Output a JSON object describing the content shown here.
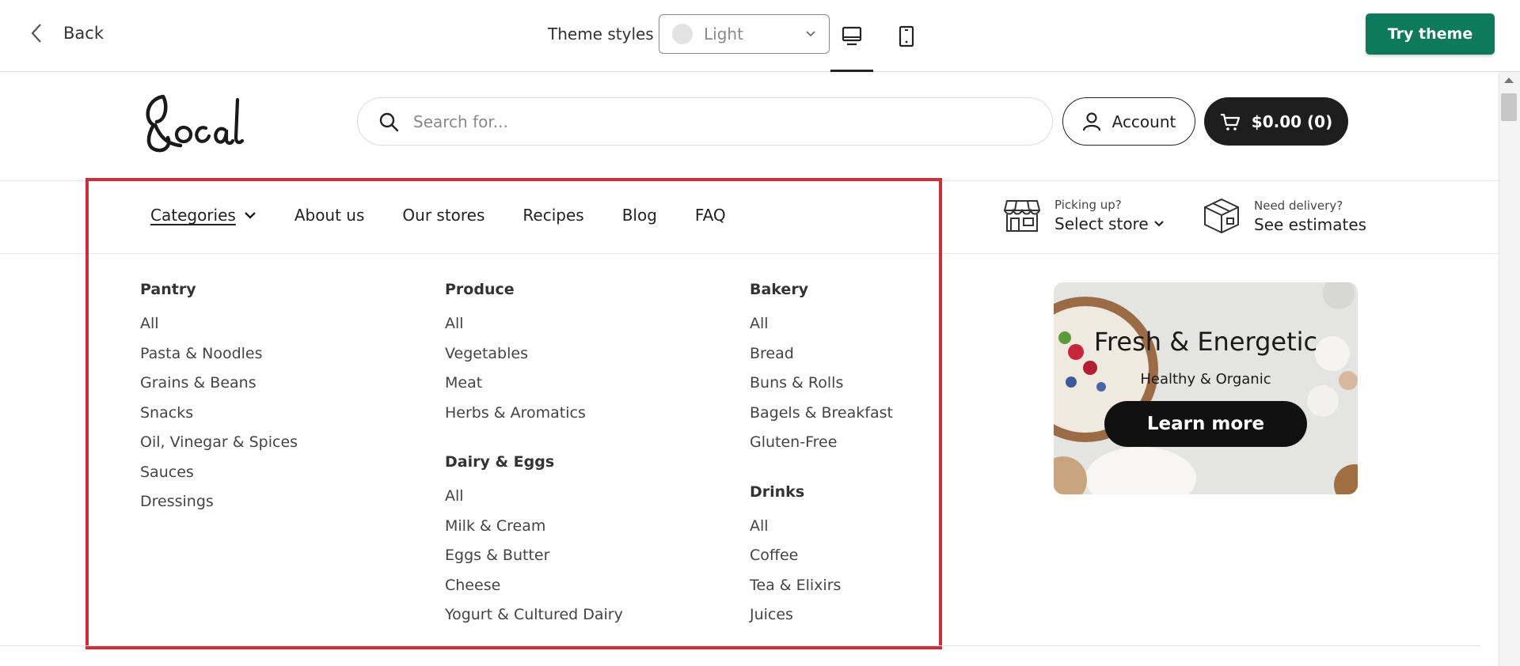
{
  "topbar": {
    "back_label": "Back",
    "theme_styles_label": "Theme styles",
    "theme_value": "Light",
    "try_theme_label": "Try theme",
    "accent": "#0e7a5c"
  },
  "header": {
    "logo_text": "Local",
    "search_placeholder": "Search for...",
    "account_label": "Account",
    "cart_label": "$0.00 (0)"
  },
  "nav": {
    "items": [
      "Categories",
      "About us",
      "Our stores",
      "Recipes",
      "Blog",
      "FAQ"
    ]
  },
  "pickup": {
    "small": "Picking up?",
    "big": "Select store"
  },
  "delivery": {
    "small": "Need delivery?",
    "big": "See estimates"
  },
  "megamenu": {
    "highlight_color": "#cc2f3a",
    "pantry": {
      "title": "Pantry",
      "links": [
        "All",
        "Pasta & Noodles",
        "Grains & Beans",
        "Snacks",
        "Oil, Vinegar & Spices",
        "Sauces",
        "Dressings"
      ]
    },
    "produce": {
      "title": "Produce",
      "links": [
        "All",
        "Vegetables",
        "Meat",
        "Herbs & Aromatics"
      ]
    },
    "dairy": {
      "title": "Dairy & Eggs",
      "links": [
        "All",
        "Milk & Cream",
        "Eggs & Butter",
        "Cheese",
        "Yogurt & Cultured Dairy"
      ]
    },
    "bakery": {
      "title": "Bakery",
      "links": [
        "All",
        "Bread",
        "Buns & Rolls",
        "Bagels & Breakfast",
        "Gluten-Free"
      ]
    },
    "drinks": {
      "title": "Drinks",
      "links": [
        "All",
        "Coffee",
        "Tea & Elixirs",
        "Juices"
      ]
    }
  },
  "promo": {
    "title": "Fresh & Energetic",
    "subtitle": "Healthy & Organic",
    "cta": "Learn more"
  }
}
